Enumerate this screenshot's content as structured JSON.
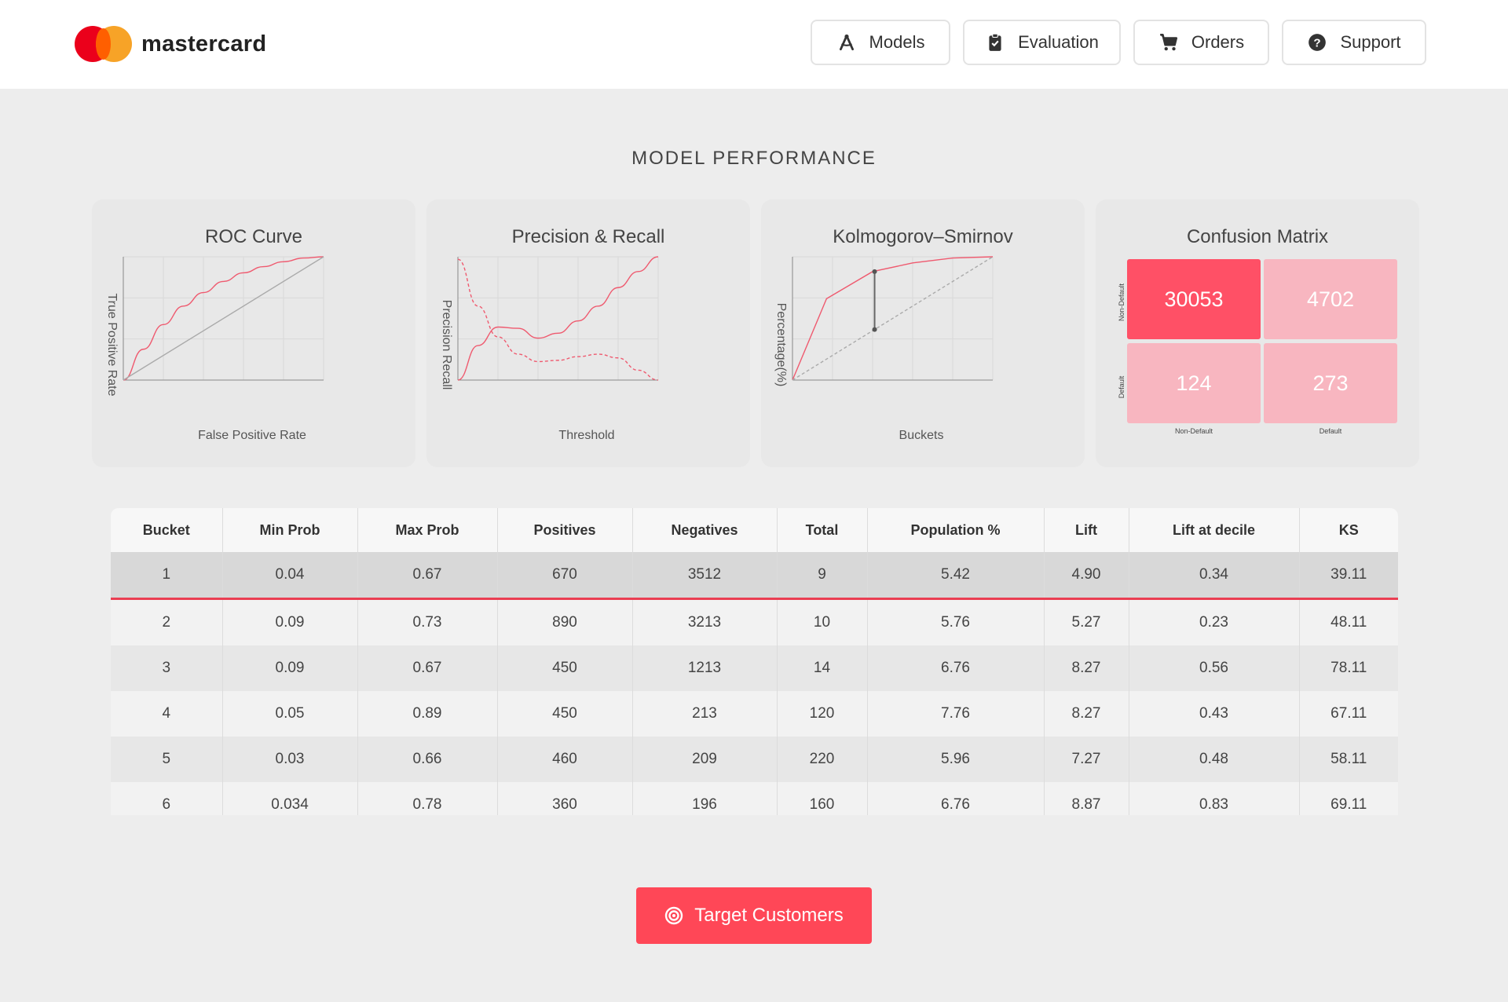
{
  "brand": {
    "name": "mastercard"
  },
  "nav": {
    "items": [
      {
        "label": "Models",
        "icon": "compass-drafting-icon"
      },
      {
        "label": "Evaluation",
        "icon": "clipboard-check-icon"
      },
      {
        "label": "Orders",
        "icon": "shopping-cart-icon"
      },
      {
        "label": "Support",
        "icon": "question-circle-icon"
      }
    ]
  },
  "page": {
    "section_title": "MODEL PERFORMANCE"
  },
  "colors": {
    "accent": "#ff4757",
    "curve": "#ef5a6f",
    "cm_strong": "#ff5066",
    "cm_light": "#f8b6c0"
  },
  "chart_data": [
    {
      "type": "line",
      "title": "ROC Curve",
      "xlabel": "False Positive Rate",
      "ylabel": "True Positive Rate",
      "xlim": [
        0,
        1
      ],
      "ylim": [
        0,
        1
      ],
      "grid": true,
      "series": [
        {
          "x": [
            0,
            0.1,
            0.2,
            0.3,
            0.4,
            0.5,
            0.6,
            0.7,
            0.8,
            0.9,
            1.0
          ],
          "y": [
            0,
            0.25,
            0.45,
            0.6,
            0.71,
            0.8,
            0.87,
            0.92,
            0.96,
            0.99,
            1.0
          ]
        },
        {
          "x": [
            0,
            1
          ],
          "y": [
            0,
            1
          ]
        }
      ]
    },
    {
      "type": "line",
      "title": "Precision & Recall",
      "xlabel": "Threshold",
      "ylabel": "Precision Recall",
      "xlim": [
        0,
        1
      ],
      "ylim": [
        0,
        1
      ],
      "grid": true,
      "series": [
        {
          "x": [
            0,
            0.1,
            0.2,
            0.3,
            0.4,
            0.5,
            0.6,
            0.7,
            0.8,
            0.9,
            1.0
          ],
          "y": [
            0,
            0.28,
            0.43,
            0.42,
            0.34,
            0.38,
            0.48,
            0.6,
            0.75,
            0.88,
            1.0
          ]
        },
        {
          "x": [
            0,
            0.1,
            0.2,
            0.3,
            0.4,
            0.5,
            0.6,
            0.7,
            0.8,
            0.9,
            1.0
          ],
          "y": [
            0.98,
            0.6,
            0.35,
            0.21,
            0.15,
            0.16,
            0.19,
            0.21,
            0.18,
            0.08,
            0.0
          ],
          "dashed": true
        }
      ]
    },
    {
      "type": "line",
      "title": "Kolmogorov–Smirnov",
      "xlabel": "Buckets",
      "ylabel": "Percentage(%)",
      "xlim": [
        0,
        1
      ],
      "ylim": [
        0,
        1
      ],
      "grid": true,
      "series": [
        {
          "x": [
            0,
            0.17,
            0.4,
            0.6,
            0.8,
            1.0
          ],
          "y": [
            0,
            0.66,
            0.88,
            0.95,
            0.99,
            1.0
          ]
        },
        {
          "x": [
            0,
            1
          ],
          "y": [
            0,
            1
          ],
          "dashed": true
        }
      ],
      "ks_marker": {
        "x": 0.41,
        "y_top": 0.88,
        "y_bottom": 0.41
      }
    },
    {
      "type": "heatmap",
      "title": "Confusion Matrix",
      "rows": [
        "Non-Default",
        "Default"
      ],
      "cols": [
        "Non-Default",
        "Default"
      ],
      "values": [
        [
          30053,
          4702
        ],
        [
          124,
          273
        ]
      ]
    }
  ],
  "table": {
    "headers": [
      "Bucket",
      "Min Prob",
      "Max Prob",
      "Positives",
      "Negatives",
      "Total",
      "Population %",
      "Lift",
      "Lift at decile",
      "KS"
    ],
    "rows": [
      [
        "1",
        "0.04",
        "0.67",
        "670",
        "3512",
        "9",
        "5.42",
        "4.90",
        "0.34",
        "39.11"
      ],
      [
        "2",
        "0.09",
        "0.73",
        "890",
        "3213",
        "10",
        "5.76",
        "5.27",
        "0.23",
        "48.11"
      ],
      [
        "3",
        "0.09",
        "0.67",
        "450",
        "1213",
        "14",
        "6.76",
        "8.27",
        "0.56",
        "78.11"
      ],
      [
        "4",
        "0.05",
        "0.89",
        "450",
        "213",
        "120",
        "7.76",
        "8.27",
        "0.43",
        "67.11"
      ],
      [
        "5",
        "0.03",
        "0.66",
        "460",
        "209",
        "220",
        "5.96",
        "7.27",
        "0.48",
        "58.11"
      ],
      [
        "6",
        "0.034",
        "0.78",
        "360",
        "196",
        "160",
        "6.76",
        "8.87",
        "0.83",
        "69.11"
      ]
    ],
    "selected_row": 0
  },
  "cta": {
    "label": "Target Customers",
    "icon": "target-icon"
  }
}
